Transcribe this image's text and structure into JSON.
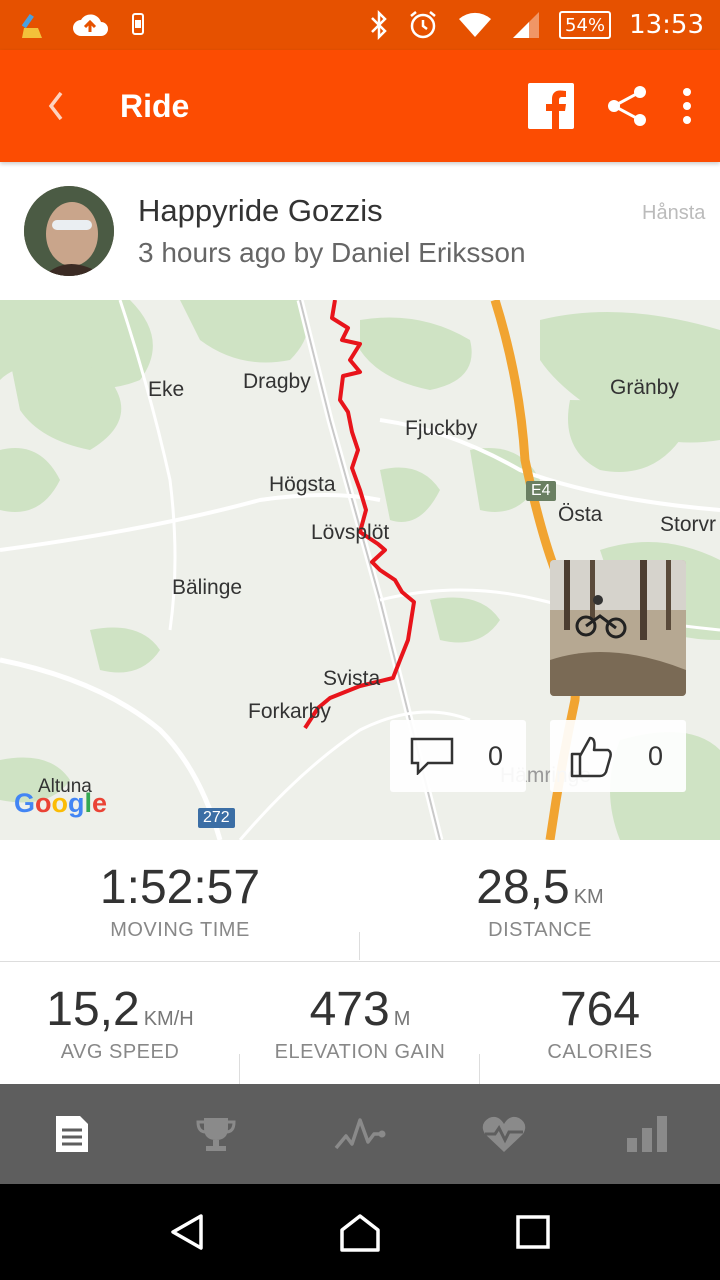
{
  "status_bar": {
    "battery": "54%",
    "time": "13:53",
    "icons": [
      "broom-icon",
      "cloud-upload-icon",
      "phone-icon",
      "bluetooth-icon",
      "alarm-icon",
      "wifi-icon",
      "signal-icon",
      "battery-icon"
    ]
  },
  "appbar": {
    "title": "Ride",
    "actions": [
      "facebook-icon",
      "share-icon",
      "more-icon"
    ],
    "color": "#fc4c02"
  },
  "activity": {
    "name": "Happyride Gozzis",
    "meta": "3 hours ago by Daniel Eriksson"
  },
  "map": {
    "places": [
      "Hånsta",
      "Eke",
      "Dragby",
      "Gränby",
      "Fjuckby",
      "Högsta",
      "Östa",
      "Storvr",
      "Lövsplöt",
      "Bälinge",
      "Svista",
      "Forkarby",
      "Altuna",
      "Hämringe"
    ],
    "road_badges": [
      "E4",
      "272"
    ],
    "attribution": "Google",
    "comments_count": "0",
    "kudos_count": "0",
    "route_color": "#e8141b"
  },
  "stats": {
    "moving_time": {
      "value": "1:52:57",
      "label": "MOVING TIME"
    },
    "distance": {
      "value": "28,5",
      "unit": "KM",
      "label": "DISTANCE"
    },
    "avg_speed": {
      "value": "15,2",
      "unit": "KM/H",
      "label": "AVG SPEED"
    },
    "elevation_gain": {
      "value": "473",
      "unit": "M",
      "label": "ELEVATION GAIN"
    },
    "calories": {
      "value": "764",
      "label": "CALORIES"
    }
  },
  "tabs": [
    "overview-icon",
    "trophy-icon",
    "analysis-icon",
    "heart-rate-icon",
    "splits-icon"
  ],
  "nav": [
    "back-icon",
    "home-icon",
    "recents-icon"
  ]
}
